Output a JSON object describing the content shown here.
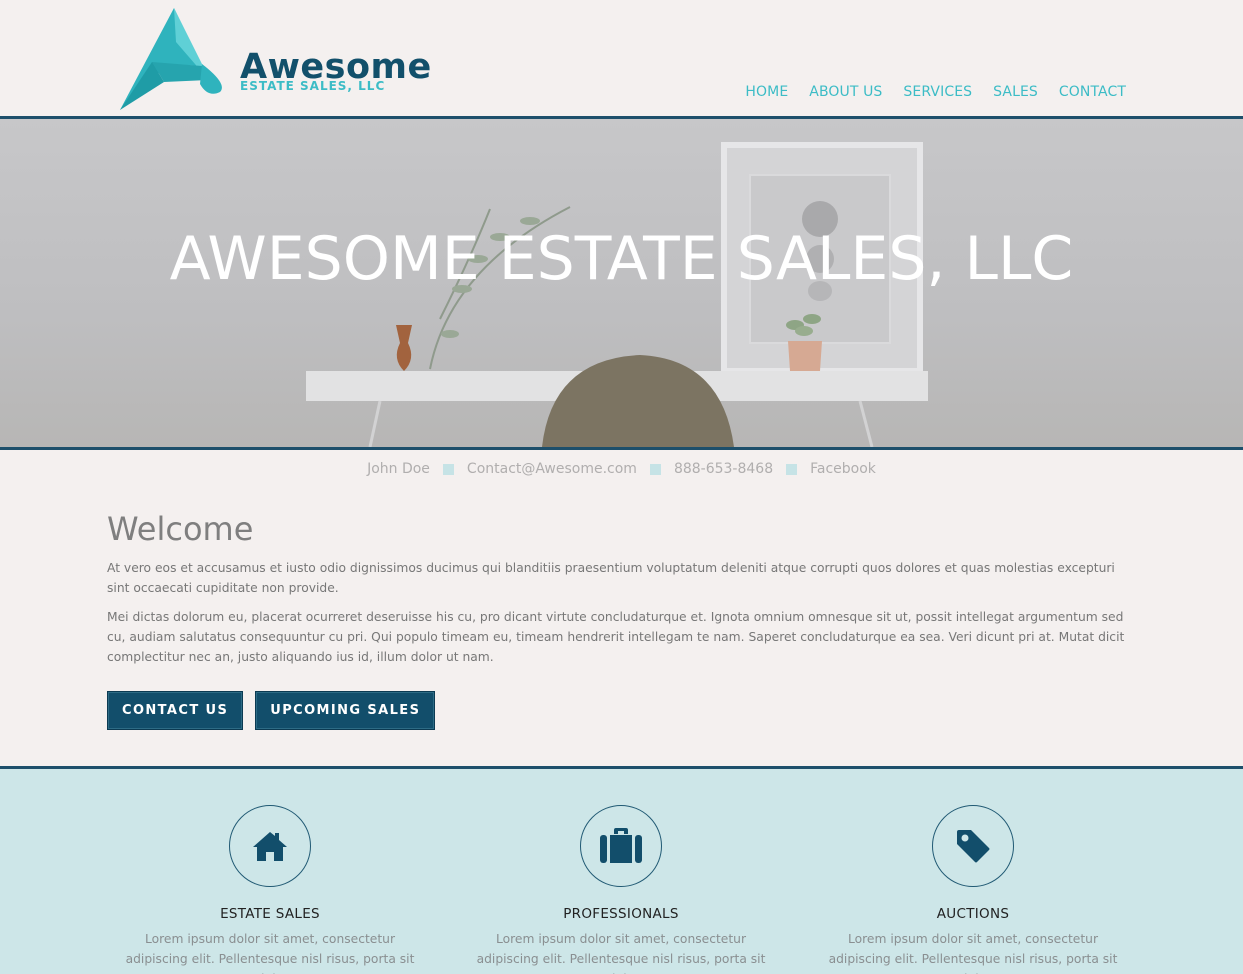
{
  "brand": {
    "name": "Awesome",
    "tagline": "ESTATE SALES, LLC"
  },
  "nav": {
    "items": [
      "HOME",
      "ABOUT US",
      "SERVICES",
      "SALES",
      "CONTACT"
    ]
  },
  "hero": {
    "title": "AWESOME ESTATE SALES, LLC"
  },
  "contact": {
    "name": "John Doe",
    "email": "Contact@Awesome.com",
    "phone": "888-653-8468",
    "social": "Facebook"
  },
  "welcome": {
    "heading": "Welcome",
    "paragraphs": [
      "At vero eos et accusamus et iusto odio dignissimos ducimus qui blanditiis praesentium voluptatum deleniti atque corrupti quos dolores et quas molestias excepturi sint occaecati cupiditate non provide.",
      "Mei dictas dolorum eu, placerat ocurreret deseruisse his cu, pro dicant virtute concludaturque et. Ignota omnium omnesque sit ut, possit intellegat argumentum sed cu, audiam salutatus consequuntur cu pri. Qui populo timeam eu, timeam hendrerit intellegam te nam. Saperet concludaturque ea sea. Veri dicunt pri at. Mutat dicit complectitur nec an, justo aliquando ius id, illum dolor ut nam."
    ],
    "buttons": {
      "contact": "CONTACT US",
      "sales": "UPCOMING SALES"
    }
  },
  "services": [
    {
      "icon": "home-icon",
      "title": "ESTATE SALES",
      "text": "Lorem ipsum dolor sit amet, consectetur adipiscing elit. Pellentesque nisl risus, porta sit amet dui eget..."
    },
    {
      "icon": "briefcase-icon",
      "title": "PROFESSIONALS",
      "text": "Lorem ipsum dolor sit amet, consectetur adipiscing elit. Pellentesque nisl risus, porta sit amet dui eget..."
    },
    {
      "icon": "tag-icon",
      "title": "AUCTIONS",
      "text": "Lorem ipsum dolor sit amet, consectetur adipiscing elit. Pellentesque nisl risus, porta sit amet dui eget..."
    }
  ],
  "colors": {
    "primary": "#124e6b",
    "accent": "#3cbcc6",
    "page_bg": "#f4f0ef",
    "services_bg": "#cde6e8"
  }
}
